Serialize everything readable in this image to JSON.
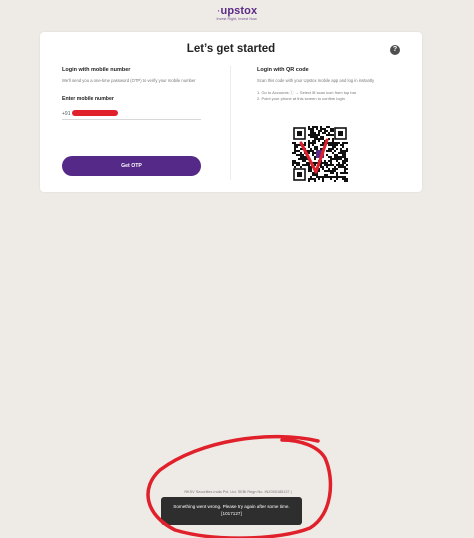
{
  "brand": {
    "name_lead": "·",
    "name": "upstox",
    "tagline": "Invest Right, Invest Now."
  },
  "card": {
    "title": "Let’s get started",
    "help_icon_glyph": "?"
  },
  "mobile_login": {
    "heading": "Login with mobile number",
    "description": "We'll send you a one-time password (OTP) to verify your mobile number",
    "input_label": "Enter mobile number",
    "country_code": "+91",
    "phone_value": "",
    "button_label": "Get OTP",
    "button_color": "#552987"
  },
  "qr_login": {
    "heading": "Login with QR code",
    "description": "Scan this code with your Upstox mobile app and log in instantly",
    "steps": [
      "1. Go to Accounts ⓘ → Select ⊞ scan icon from top bar",
      "2. Point your phone at this screen to confirm login"
    ]
  },
  "footer": {
    "registration_text": "RKSV Securities India Pvt. Ltd. SEBI Regn No. INZ000185137 |"
  },
  "toast": {
    "message": "Something went wrong. Please try again after some time. [1017127]"
  },
  "colors": {
    "background": "#eeebe6",
    "brand": "#5a2a86",
    "annotation": "#e0202a"
  }
}
